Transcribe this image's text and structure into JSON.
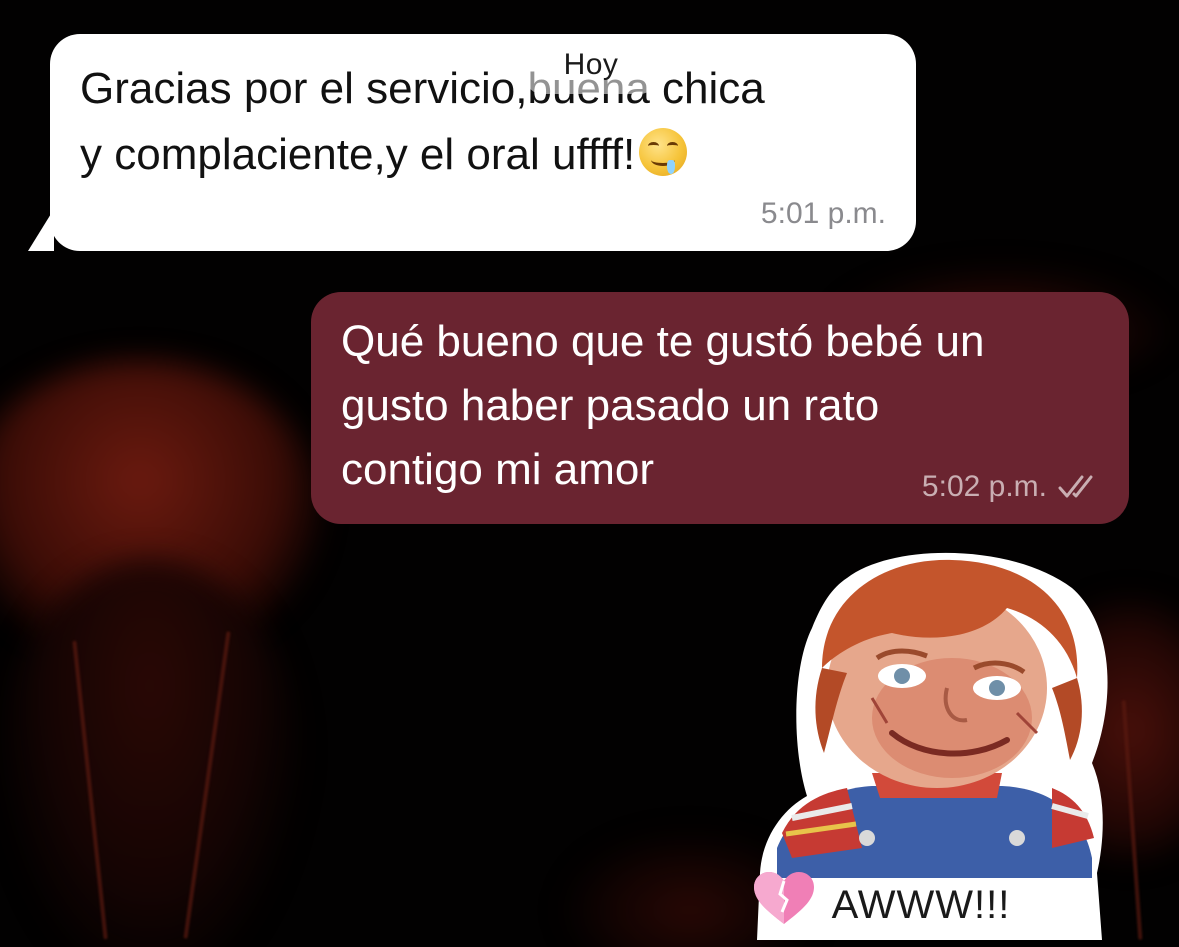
{
  "chat": {
    "date_label": "Hoy",
    "messages": [
      {
        "direction": "incoming",
        "line1": "Gracias por el servicio,buena chica",
        "line2": "y complaciente,y el oral uffff!",
        "emoji": "drooling-face-icon",
        "time": "5:01 p.m."
      },
      {
        "direction": "outgoing",
        "line1": "Qué bueno que te gustó bebé un",
        "line2": "gusto haber pasado un rato",
        "line3": "contigo mi amor",
        "time": "5:02 p.m.",
        "status_icon": "double-check-icon"
      }
    ],
    "sticker": {
      "caption": "AWWW!!!",
      "icon": "pink-heart-icon",
      "subject": "chucky-doll-sticker"
    }
  },
  "colors": {
    "background": "#020101",
    "incoming_bubble": "#ffffff",
    "outgoing_bubble": "#6a2430",
    "timestamp_incoming": "#8a8a8e",
    "timestamp_outgoing": "#c9aeb2"
  }
}
